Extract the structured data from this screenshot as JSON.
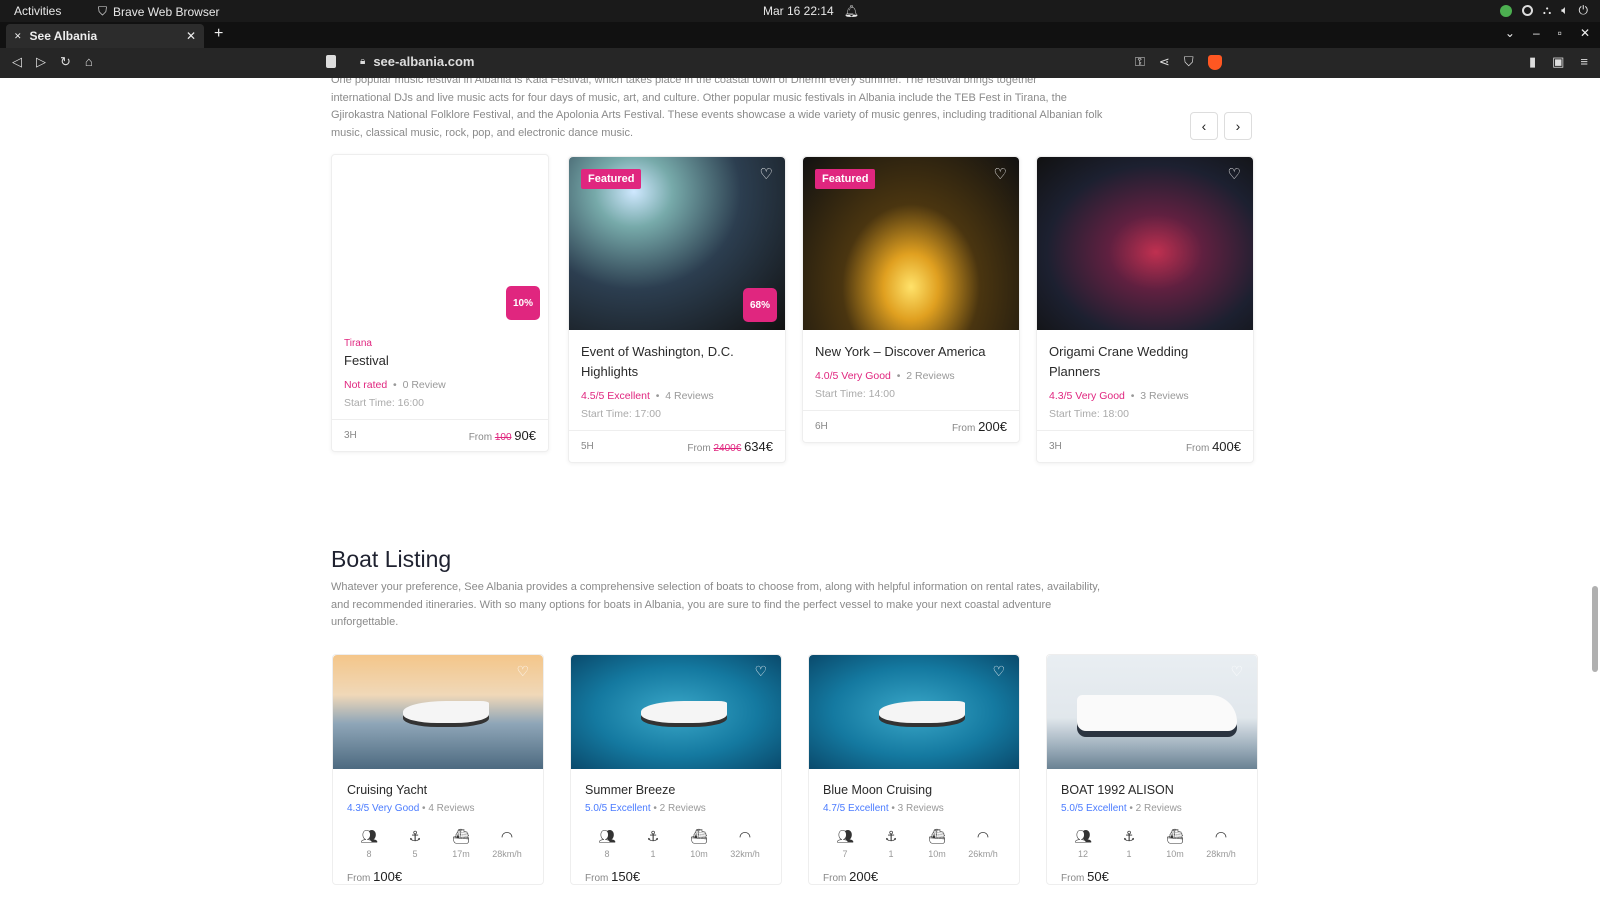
{
  "os": {
    "activities": "Activities",
    "app_name": "Brave Web Browser",
    "clock": "Mar 16 22:14"
  },
  "browser": {
    "tab_title": "See Albania",
    "url": "see-albania.com"
  },
  "events": {
    "intro_lines": [
      "One popular music festival in Albania is Kala Festival, which takes place in the coastal town of Dhërmi every summer. The festival brings together",
      "international DJs and live music acts for four days of music, art, and culture. Other popular music festivals in Albania include the TEB Fest in Tirana, the",
      "Gjirokastra National Folklore Festival, and the Apolonia Arts Festival. These events showcase a wide variety of music genres, including traditional Albanian folk",
      "music, classical music, rock, pop, and electronic dance music."
    ],
    "cards": [
      {
        "badge": "",
        "discount": "10%",
        "location": "Tirana",
        "title": "Festival",
        "rating": "Not rated",
        "reviews": "0 Review",
        "start": "Start Time: 16:00",
        "duration": "3H",
        "from": "From",
        "old_price": "100",
        "price": "90€"
      },
      {
        "badge": "Featured",
        "discount": "68%",
        "location": "",
        "title": "Event of Washington, D.C. Highlights",
        "rating": "4.5/5 Excellent",
        "reviews": "4 Reviews",
        "start": "Start Time: 17:00",
        "duration": "5H",
        "from": "From",
        "old_price": "2400€",
        "price": "634€"
      },
      {
        "badge": "Featured",
        "discount": "",
        "location": "",
        "title": "New York – Discover America",
        "rating": "4.0/5 Very Good",
        "reviews": "2 Reviews",
        "start": "Start Time: 14:00",
        "duration": "6H",
        "from": "From",
        "old_price": "",
        "price": "200€"
      },
      {
        "badge": "",
        "discount": "",
        "location": "",
        "title": "Origami Crane Wedding Planners",
        "rating": "4.3/5 Very Good",
        "reviews": "3 Reviews",
        "start": "Start Time: 18:00",
        "duration": "3H",
        "from": "From",
        "old_price": "",
        "price": "400€"
      }
    ]
  },
  "boats": {
    "title": "Boat Listing",
    "desc_lines": [
      "Whatever your preference, See Albania provides a comprehensive selection of boats to choose from, along with helpful information on rental rates, availability,",
      "and recommended itineraries. With so many options for boats in Albania, you are sure to find the perfect vessel to make your next coastal adventure",
      "unforgettable."
    ],
    "cards": [
      {
        "name": "Cruising Yacht",
        "rating": "4.3/5 Very Good",
        "reviews": "4 Reviews",
        "guests": "8",
        "cabins": "5",
        "length": "17m",
        "speed": "28km/h",
        "from": "From",
        "price": "100€"
      },
      {
        "name": "Summer Breeze",
        "rating": "5.0/5 Excellent",
        "reviews": "2 Reviews",
        "guests": "8",
        "cabins": "1",
        "length": "10m",
        "speed": "32km/h",
        "from": "From",
        "price": "150€"
      },
      {
        "name": "Blue Moon Cruising",
        "rating": "4.7/5 Excellent",
        "reviews": "3 Reviews",
        "guests": "7",
        "cabins": "1",
        "length": "10m",
        "speed": "26km/h",
        "from": "From",
        "price": "200€"
      },
      {
        "name": "BOAT 1992 ALISON",
        "rating": "5.0/5 Excellent",
        "reviews": "2 Reviews",
        "guests": "12",
        "cabins": "1",
        "length": "10m",
        "speed": "28km/h",
        "from": "From",
        "price": "50€"
      }
    ]
  },
  "colors": {
    "accent": "#e0267f",
    "rating_blue": "#4a7bff"
  }
}
